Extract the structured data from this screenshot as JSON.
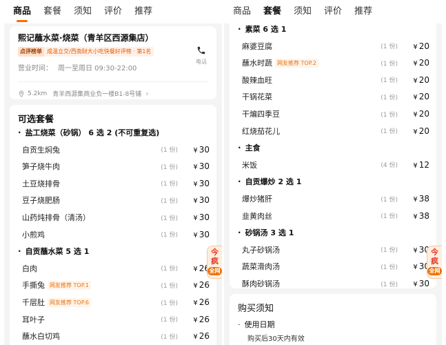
{
  "tabs": [
    "商品",
    "套餐",
    "须知",
    "评价",
    "推荐"
  ],
  "left": {
    "active_tab": 0,
    "store": {
      "name": "熙记蘸水菜·烧菜（青羊区西源集店）",
      "rank_tag": "点评榜单",
      "rank_text": "成温立交/西南财大小吃快餐好评榜 · 第1名",
      "hours_label": "营业时间：",
      "hours_value": "周一至周日 09:30-22:00",
      "phone_label": "电话",
      "distance": "5.2km",
      "address": "青羊西源集商业负一楼B1-8号铺"
    },
    "section_title": "可选套餐",
    "rows": [
      {
        "type": "group",
        "name": "盐工烧菜（砂锅） 6 选 2 (不可重复选)"
      },
      {
        "type": "item",
        "name": "自贡生焖兔",
        "qty": "(1 份)",
        "price": "30"
      },
      {
        "type": "item",
        "name": "笋子烧牛肉",
        "qty": "(1 份)",
        "price": "30"
      },
      {
        "type": "item",
        "name": "土豆烧排骨",
        "qty": "(1 份)",
        "price": "30"
      },
      {
        "type": "item",
        "name": "豆子烧肥肠",
        "qty": "(1 份)",
        "price": "30"
      },
      {
        "type": "item",
        "name": "山药炖排骨（清汤）",
        "qty": "(1 份)",
        "price": "30"
      },
      {
        "type": "item",
        "name": "小煎鸡",
        "qty": "(1 份)",
        "price": "30"
      },
      {
        "type": "group",
        "name": "自贡蘸水菜 5 选 1"
      },
      {
        "type": "item",
        "name": "白肉",
        "qty": "(1 份)",
        "price": "26"
      },
      {
        "type": "item",
        "name": "手撕兔",
        "badge": "网友推荐 TOP.1",
        "qty": "(1 份)",
        "price": "26"
      },
      {
        "type": "item",
        "name": "千层肚",
        "badge": "网友推荐 TOP.6",
        "qty": "(1 份)",
        "price": "26"
      },
      {
        "type": "item",
        "name": "耳叶子",
        "qty": "(1 份)",
        "price": "26"
      },
      {
        "type": "item",
        "name": "蘸水白切鸡",
        "qty": "(1 份)",
        "price": "26"
      }
    ],
    "promo": {
      "main": "今疯",
      "sub": "全网"
    }
  },
  "right": {
    "active_tab": 1,
    "rows": [
      {
        "type": "group",
        "name": "素菜 6 选 1"
      },
      {
        "type": "item",
        "name": "麻婆豆腐",
        "qty": "(1 份)",
        "price": "20"
      },
      {
        "type": "item",
        "name": "蘸水时蔬",
        "badge": "网友推荐 TOP.2",
        "qty": "(1 份)",
        "price": "20"
      },
      {
        "type": "item",
        "name": "酸辣血旺",
        "qty": "(1 份)",
        "price": "20"
      },
      {
        "type": "item",
        "name": "干锅花菜",
        "qty": "(1 份)",
        "price": "20"
      },
      {
        "type": "item",
        "name": "干煸四季豆",
        "qty": "(1 份)",
        "price": "20"
      },
      {
        "type": "item",
        "name": "红烧茄花儿",
        "qty": "(1 份)",
        "price": "20"
      },
      {
        "type": "group",
        "name": "主食"
      },
      {
        "type": "item",
        "name": "米饭",
        "qty": "(4 份)",
        "price": "12"
      },
      {
        "type": "group",
        "name": "自贡爆炒 2 选 1"
      },
      {
        "type": "item",
        "name": "爆炒猪肝",
        "qty": "(1 份)",
        "price": "38"
      },
      {
        "type": "item",
        "name": "韭黄肉丝",
        "qty": "(1 份)",
        "price": "38"
      },
      {
        "type": "group",
        "name": "砂锅汤 3 选 1"
      },
      {
        "type": "item",
        "name": "丸子砂锅汤",
        "qty": "(1 份)",
        "price": "30"
      },
      {
        "type": "item",
        "name": "蔬菜滑肉汤",
        "qty": "(1 份)",
        "price": "30"
      },
      {
        "type": "item",
        "name": "酥肉砂锅汤",
        "qty": "(1 份)",
        "price": "30"
      }
    ],
    "promo": {
      "main": "今疯",
      "sub": "全网"
    },
    "notice": {
      "title": "购买须知",
      "sub_title": "使用日期",
      "text": "购买后30天内有效"
    }
  },
  "currency_symbol": "¥"
}
